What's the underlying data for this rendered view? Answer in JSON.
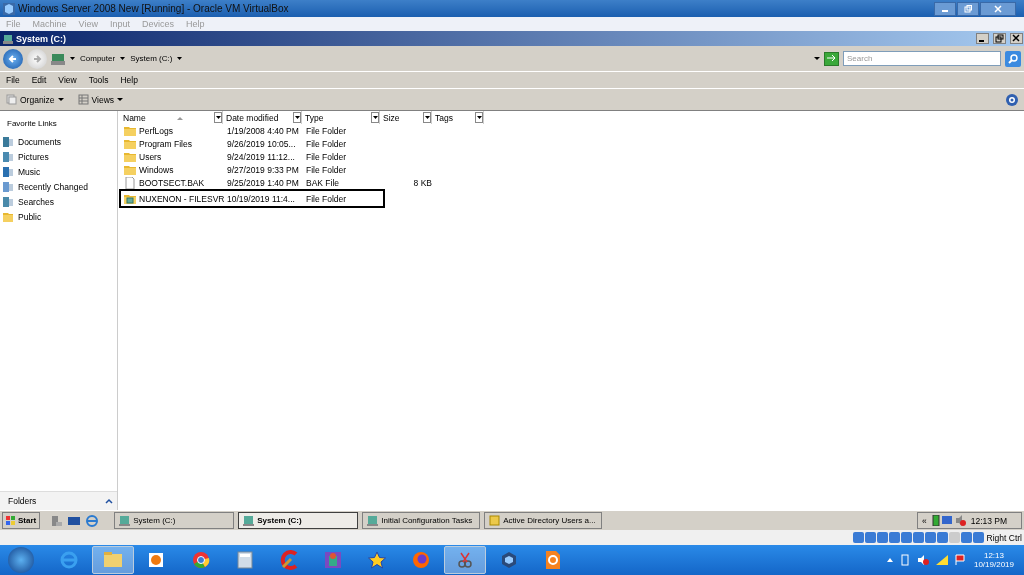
{
  "host_window": {
    "title": "Windows Server 2008 New [Running] - Oracle VM VirtualBox",
    "menu": [
      "File",
      "Machine",
      "View",
      "Input",
      "Devices",
      "Help"
    ]
  },
  "window": {
    "title": "System (C:)"
  },
  "address": {
    "crumbs": [
      "Computer",
      "System (C:)"
    ]
  },
  "search": {
    "placeholder": "Search"
  },
  "menu": [
    "File",
    "Edit",
    "View",
    "Tools",
    "Help"
  ],
  "toolbar": [
    "Organize",
    "Views"
  ],
  "sidebar": {
    "title": "Favorite Links",
    "items": [
      {
        "label": "Documents",
        "kind": "documents"
      },
      {
        "label": "Pictures",
        "kind": "pictures"
      },
      {
        "label": "Music",
        "kind": "music"
      },
      {
        "label": "Recently Changed",
        "kind": "recent"
      },
      {
        "label": "Searches",
        "kind": "searches"
      },
      {
        "label": "Public",
        "kind": "folder"
      }
    ],
    "footer": "Folders"
  },
  "table": {
    "columns": [
      "Name",
      "Date modified",
      "Type",
      "Size",
      "Tags"
    ],
    "rows": [
      {
        "kind": "folder",
        "name": "PerfLogs",
        "date": "1/19/2008 4:40 PM",
        "type": "File Folder",
        "annotated": false
      },
      {
        "kind": "folder",
        "name": "Program Files",
        "date": "9/26/2019 10:05...",
        "type": "File Folder",
        "annotated": false
      },
      {
        "kind": "folder",
        "name": "Users",
        "date": "9/24/2019 11:12...",
        "type": "File Folder",
        "annotated": false
      },
      {
        "kind": "folder",
        "name": "Windows",
        "date": "9/27/2019 9:33 PM",
        "type": "File Folder",
        "annotated": false
      },
      {
        "kind": "file",
        "name": "BOOTSECT.BAK",
        "date": "9/25/2019 1:40 PM",
        "type": "BAK File",
        "size": "8 KB",
        "annotated": false
      },
      {
        "kind": "share",
        "name": "NUXENON - FILESVR",
        "date": "10/19/2019 11:4...",
        "type": "File Folder",
        "annotated": true
      }
    ]
  },
  "guest_taskbar": {
    "start": "Start",
    "buttons": [
      {
        "label": "System (C:)",
        "selected": false
      },
      {
        "label": "System (C:)",
        "selected": true
      },
      {
        "label": "Initial Configuration Tasks",
        "selected": false
      },
      {
        "label": "Active Directory Users a...",
        "selected": false
      }
    ],
    "tray_chevron": "«",
    "time": "12:13 PM"
  },
  "vbox_status": {
    "host_key": "Right Ctrl"
  },
  "host_taskbar": {
    "apps": [
      {
        "kind": "ie",
        "selected": false
      },
      {
        "kind": "explorer",
        "selected": true
      },
      {
        "kind": "media",
        "selected": false
      },
      {
        "kind": "chrome",
        "selected": false
      },
      {
        "kind": "calculator",
        "selected": false
      },
      {
        "kind": "cleaner",
        "selected": false
      },
      {
        "kind": "game",
        "selected": false
      },
      {
        "kind": "star",
        "selected": false
      },
      {
        "kind": "firefox",
        "selected": false
      },
      {
        "kind": "snipping",
        "selected": true
      },
      {
        "kind": "virtualbox",
        "selected": false
      },
      {
        "kind": "pdf",
        "selected": false
      }
    ],
    "time": "12:13",
    "date": "10/19/2019"
  }
}
